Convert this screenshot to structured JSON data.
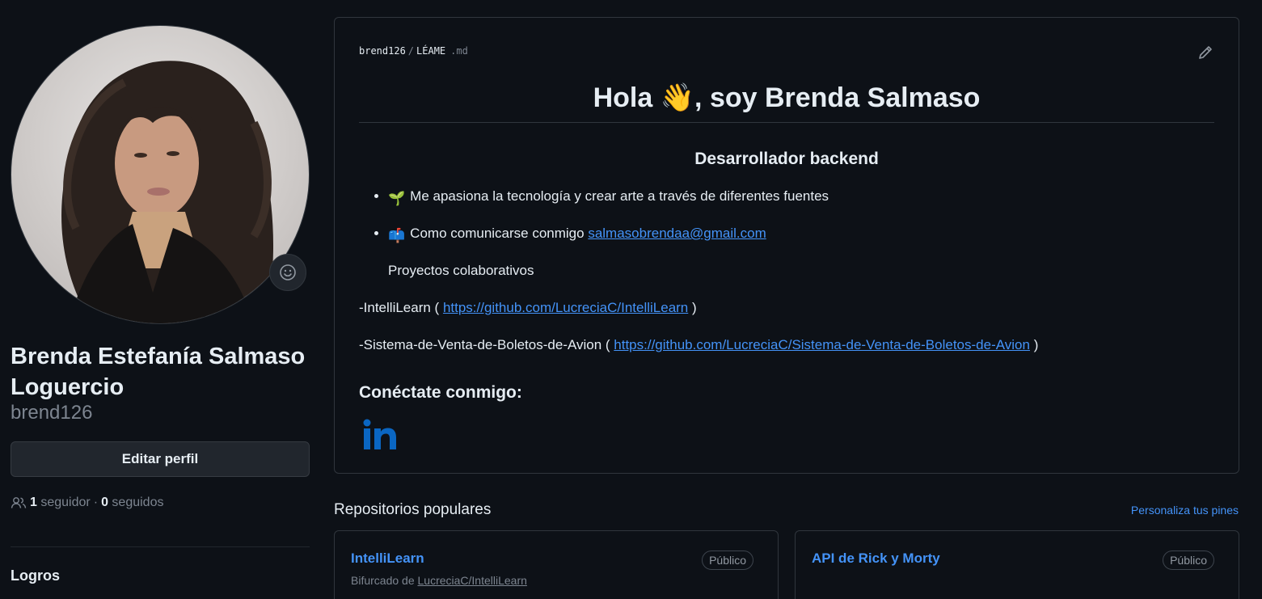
{
  "profile": {
    "full_name": "Brenda Estefanía Salmaso Loguercio",
    "login": "brend126",
    "edit_button": "Editar perfil",
    "followers_count": "1",
    "followers_label": "seguidor",
    "separator": "·",
    "following_count": "0",
    "following_label": "seguidos",
    "achievements_title": "Logros"
  },
  "readme": {
    "path_user": "brend126",
    "path_sep": "/",
    "path_file": "LÉAME",
    "path_ext": ".md",
    "heading_prefix": "Hola ",
    "heading_emoji": "👋",
    "heading_suffix": ", soy Brenda Salmaso",
    "subheading": "Desarrollador backend",
    "bullet1_emoji": "🌱",
    "bullet1_text": "Me apasiona la tecnología y crear arte a través de diferentes fuentes",
    "bullet2_emoji": "📫",
    "bullet2_text": "Como comunicarse conmigo ",
    "bullet2_email": "salmasobrendaa@gmail.com",
    "collab_text": "Proyectos colaborativos",
    "project1_prefix": "-IntelliLearn ( ",
    "project1_link": "https://github.com/LucreciaC/IntelliLearn",
    "project1_suffix": " )",
    "project2_prefix": "-Sistema-de-Venta-de-Boletos-de-Avion ( ",
    "project2_link": "https://github.com/LucreciaC/Sistema-de-Venta-de-Boletos-de-Avion",
    "project2_suffix": " )",
    "connect_heading": "Conéctate conmigo:",
    "linkedin_icon": "linkedin-icon"
  },
  "repos": {
    "title": "Repositorios populares",
    "customize_link": "Personaliza tus pines",
    "items": [
      {
        "name": "IntelliLearn",
        "visibility": "Público",
        "fork_prefix": "Bifurcado de ",
        "fork_source": "LucreciaC/IntelliLearn"
      },
      {
        "name": "API de Rick y Morty",
        "visibility": "Público"
      }
    ]
  },
  "colors": {
    "background": "#0d1117",
    "text": "#e6edf3",
    "muted": "#7d8590",
    "link": "#4493f8",
    "border": "#30363d",
    "linkedin": "#0a66c2"
  }
}
